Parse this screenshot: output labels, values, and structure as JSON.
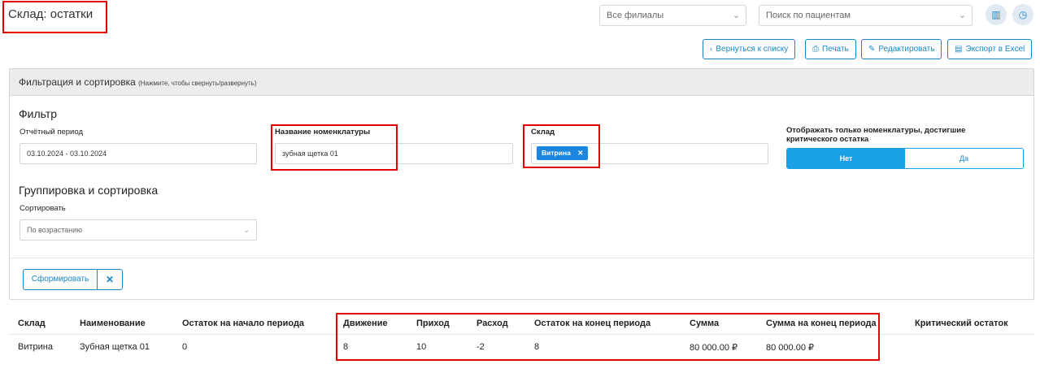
{
  "header": {
    "title": "Склад: остатки",
    "branches_select": "Все филиалы",
    "patient_search_placeholder": "Поиск по пациентам"
  },
  "toolbar": {
    "back_label": "Вернуться к списку",
    "print_label": "Печать",
    "edit_label": "Редактировать",
    "export_label": "Экспорт в Excel"
  },
  "panel": {
    "title": "Фильтрация и сортировка",
    "hint": "(Нажмите, чтобы свернуть/развернуть)",
    "filter_title": "Фильтр",
    "period_label": "Отчётный период",
    "period_value": "03.10.2024 - 03.10.2024",
    "nomenclature_label": "Название номенклатуры",
    "nomenclature_value": "зубная щетка 01",
    "warehouse_label": "Склад",
    "warehouse_tag": "Витрина",
    "critical_label": "Отображать только номенклатуры, достигшие критического остатка",
    "critical_no": "Нет",
    "critical_yes": "Да",
    "grouping_title": "Группировка и сортировка",
    "sort_label": "Сортировать",
    "sort_value": "По возрастанию",
    "build_button": "Сформировать"
  },
  "table": {
    "headers": [
      "Склад",
      "Наименование",
      "Остаток на начало периода",
      "Движение",
      "Приход",
      "Расход",
      "Остаток на конец периода",
      "Сумма",
      "Сумма на конец периода",
      "Критический остаток"
    ],
    "rows": [
      [
        "Витрина",
        "Зубная щетка 01",
        "0",
        "8",
        "10",
        "-2",
        "8",
        "80 000.00 ₽",
        "80 000.00 ₽",
        ""
      ]
    ]
  },
  "colors": {
    "accent": "#1a86c9",
    "toggle_active": "#1aa0e6",
    "highlight": "#e00000"
  }
}
